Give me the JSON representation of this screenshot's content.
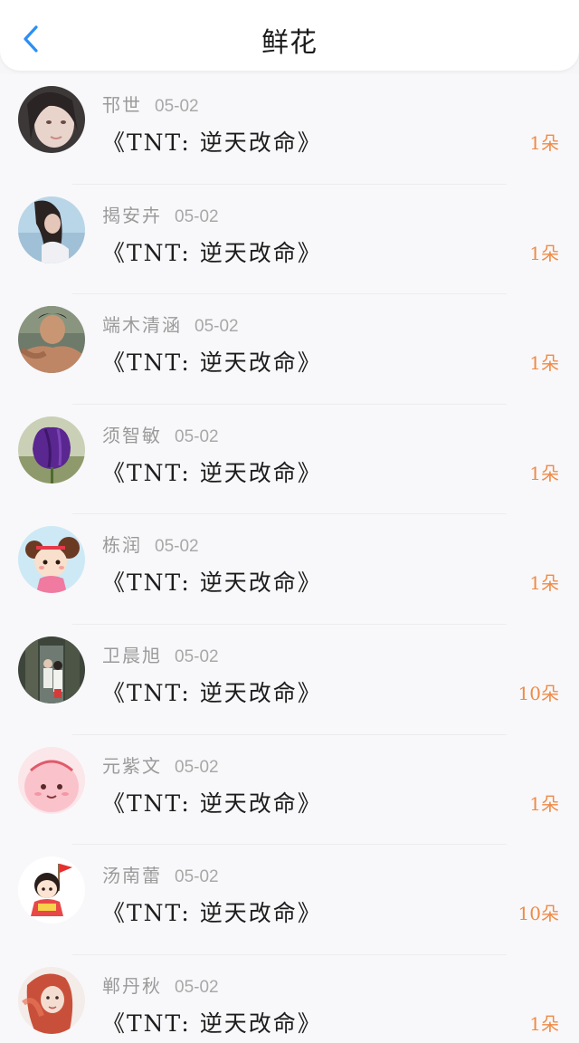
{
  "header": {
    "title": "鲜花",
    "back_icon": "chevron-left-icon",
    "accent": "#2b8ff5"
  },
  "colors": {
    "count": "#f08a46",
    "meta": "#9a9a9a"
  },
  "items": [
    {
      "name": "邗世",
      "date": "05-02",
      "book": "《TNT: 逆天改命》",
      "count": "1朵",
      "avatar": "avatar-girl-1"
    },
    {
      "name": "揭安卉",
      "date": "05-02",
      "book": "《TNT: 逆天改命》",
      "count": "1朵",
      "avatar": "avatar-girl-hair"
    },
    {
      "name": "端木清涵",
      "date": "05-02",
      "book": "《TNT: 逆天改命》",
      "count": "1朵",
      "avatar": "avatar-man"
    },
    {
      "name": "须智敏",
      "date": "05-02",
      "book": "《TNT: 逆天改命》",
      "count": "1朵",
      "avatar": "avatar-purple-flower"
    },
    {
      "name": "栋润",
      "date": "05-02",
      "book": "《TNT: 逆天改命》",
      "count": "1朵",
      "avatar": "avatar-cartoon-girl"
    },
    {
      "name": "卫晨旭",
      "date": "05-02",
      "book": "《TNT: 逆天改命》",
      "count": "10朵",
      "avatar": "avatar-couple"
    },
    {
      "name": "元紫文",
      "date": "05-02",
      "book": "《TNT: 逆天改命》",
      "count": "1朵",
      "avatar": "avatar-pink-character"
    },
    {
      "name": "汤南蕾",
      "date": "05-02",
      "book": "《TNT: 逆天改命》",
      "count": "10朵",
      "avatar": "avatar-cartoon-flag"
    },
    {
      "name": "郸丹秋",
      "date": "05-02",
      "book": "《TNT: 逆天改命》",
      "count": "1朵",
      "avatar": "avatar-girl-red"
    }
  ]
}
